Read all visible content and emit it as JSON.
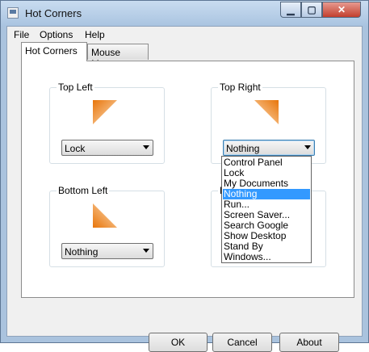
{
  "window": {
    "title": "Hot Corners",
    "minimize_glyph": "▁",
    "maximize_glyph": "▢",
    "close_glyph": "✕"
  },
  "menubar": {
    "items": [
      {
        "label": "File"
      },
      {
        "label": "Options"
      },
      {
        "label": "Help"
      }
    ]
  },
  "tabs": [
    {
      "label": "Hot Corners",
      "active": true
    },
    {
      "label": "Mouse Move",
      "active": false
    }
  ],
  "corners": {
    "top_left": {
      "label": "Top Left",
      "value": "Lock"
    },
    "top_right": {
      "label": "Top Right",
      "value": "Nothing"
    },
    "bottom_left": {
      "label": "Bottom Left",
      "value": "Nothing"
    },
    "bottom_right": {
      "label": "B"
    }
  },
  "dropdown": {
    "options": [
      {
        "label": "Control Panel"
      },
      {
        "label": "Lock"
      },
      {
        "label": "My Documents"
      },
      {
        "label": "Nothing"
      },
      {
        "label": "Run..."
      },
      {
        "label": "Screen Saver..."
      },
      {
        "label": "Search Google"
      },
      {
        "label": "Show Desktop"
      },
      {
        "label": "Stand By"
      },
      {
        "label": "Windows..."
      }
    ],
    "selected": "Nothing"
  },
  "buttons": {
    "ok": "OK",
    "cancel": "Cancel",
    "about": "About"
  },
  "colors": {
    "accent_orange": "#f0922c",
    "selection_blue": "#3399ff",
    "title_bar": "#aac3de"
  }
}
